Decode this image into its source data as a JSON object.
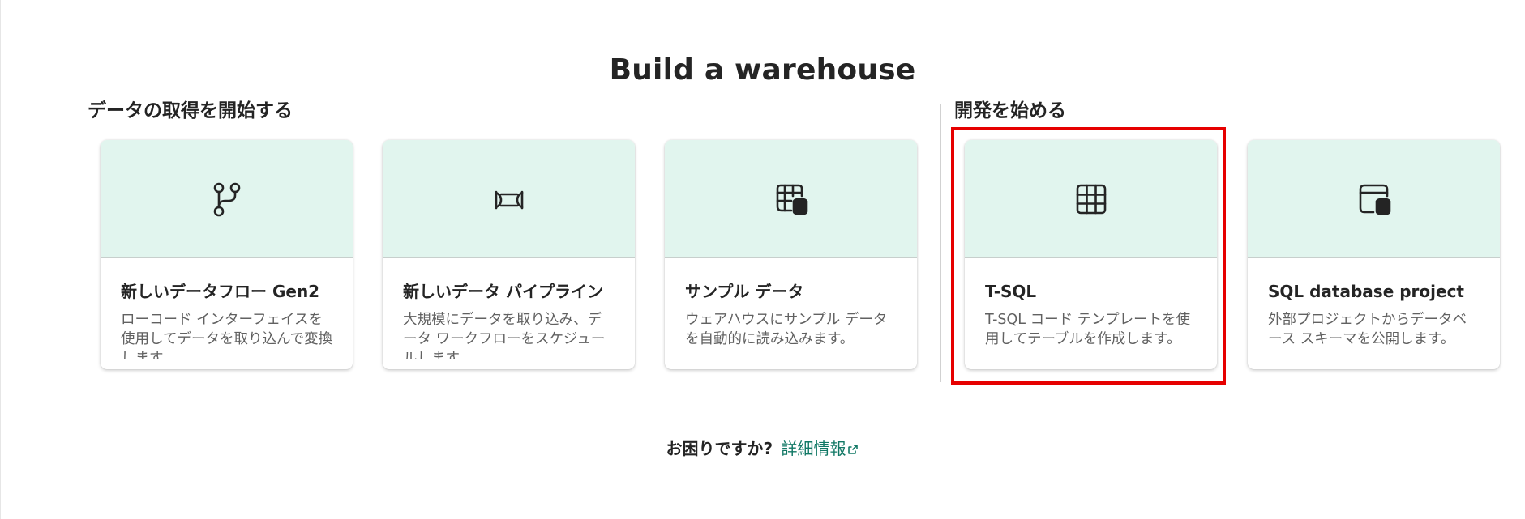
{
  "page": {
    "title": "Build a warehouse"
  },
  "sections": {
    "get_data": {
      "title": "データの取得を開始する"
    },
    "develop": {
      "title": "開発を始める"
    }
  },
  "cards": {
    "dataflow": {
      "icon": "branch-icon",
      "title": "新しいデータフロー Gen2",
      "desc": "ローコード インターフェイスを使用してデータを取り込んで変換します。"
    },
    "pipeline": {
      "icon": "pipeline-icon",
      "title": "新しいデータ パイプライン",
      "desc": "大規模にデータを取り込み、データ ワークフローをスケジュールします。"
    },
    "sample": {
      "icon": "table-database-icon",
      "title": "サンプル データ",
      "desc": "ウェアハウスにサンプル データを自動的に読み込みます。"
    },
    "tsql": {
      "icon": "table-grid-icon",
      "title": "T-SQL",
      "desc": "T-SQL コード テンプレートを使用してテーブルを作成します。"
    },
    "sqlproject": {
      "icon": "window-database-icon",
      "title": "SQL database project",
      "desc": "外部プロジェクトからデータベース スキーマを公開します。"
    }
  },
  "help": {
    "question": "お困りですか?",
    "link_label": "詳細情報"
  },
  "colors": {
    "card_header_bg": "#e1f5ee",
    "link": "#117865",
    "highlight": "#e60000"
  }
}
